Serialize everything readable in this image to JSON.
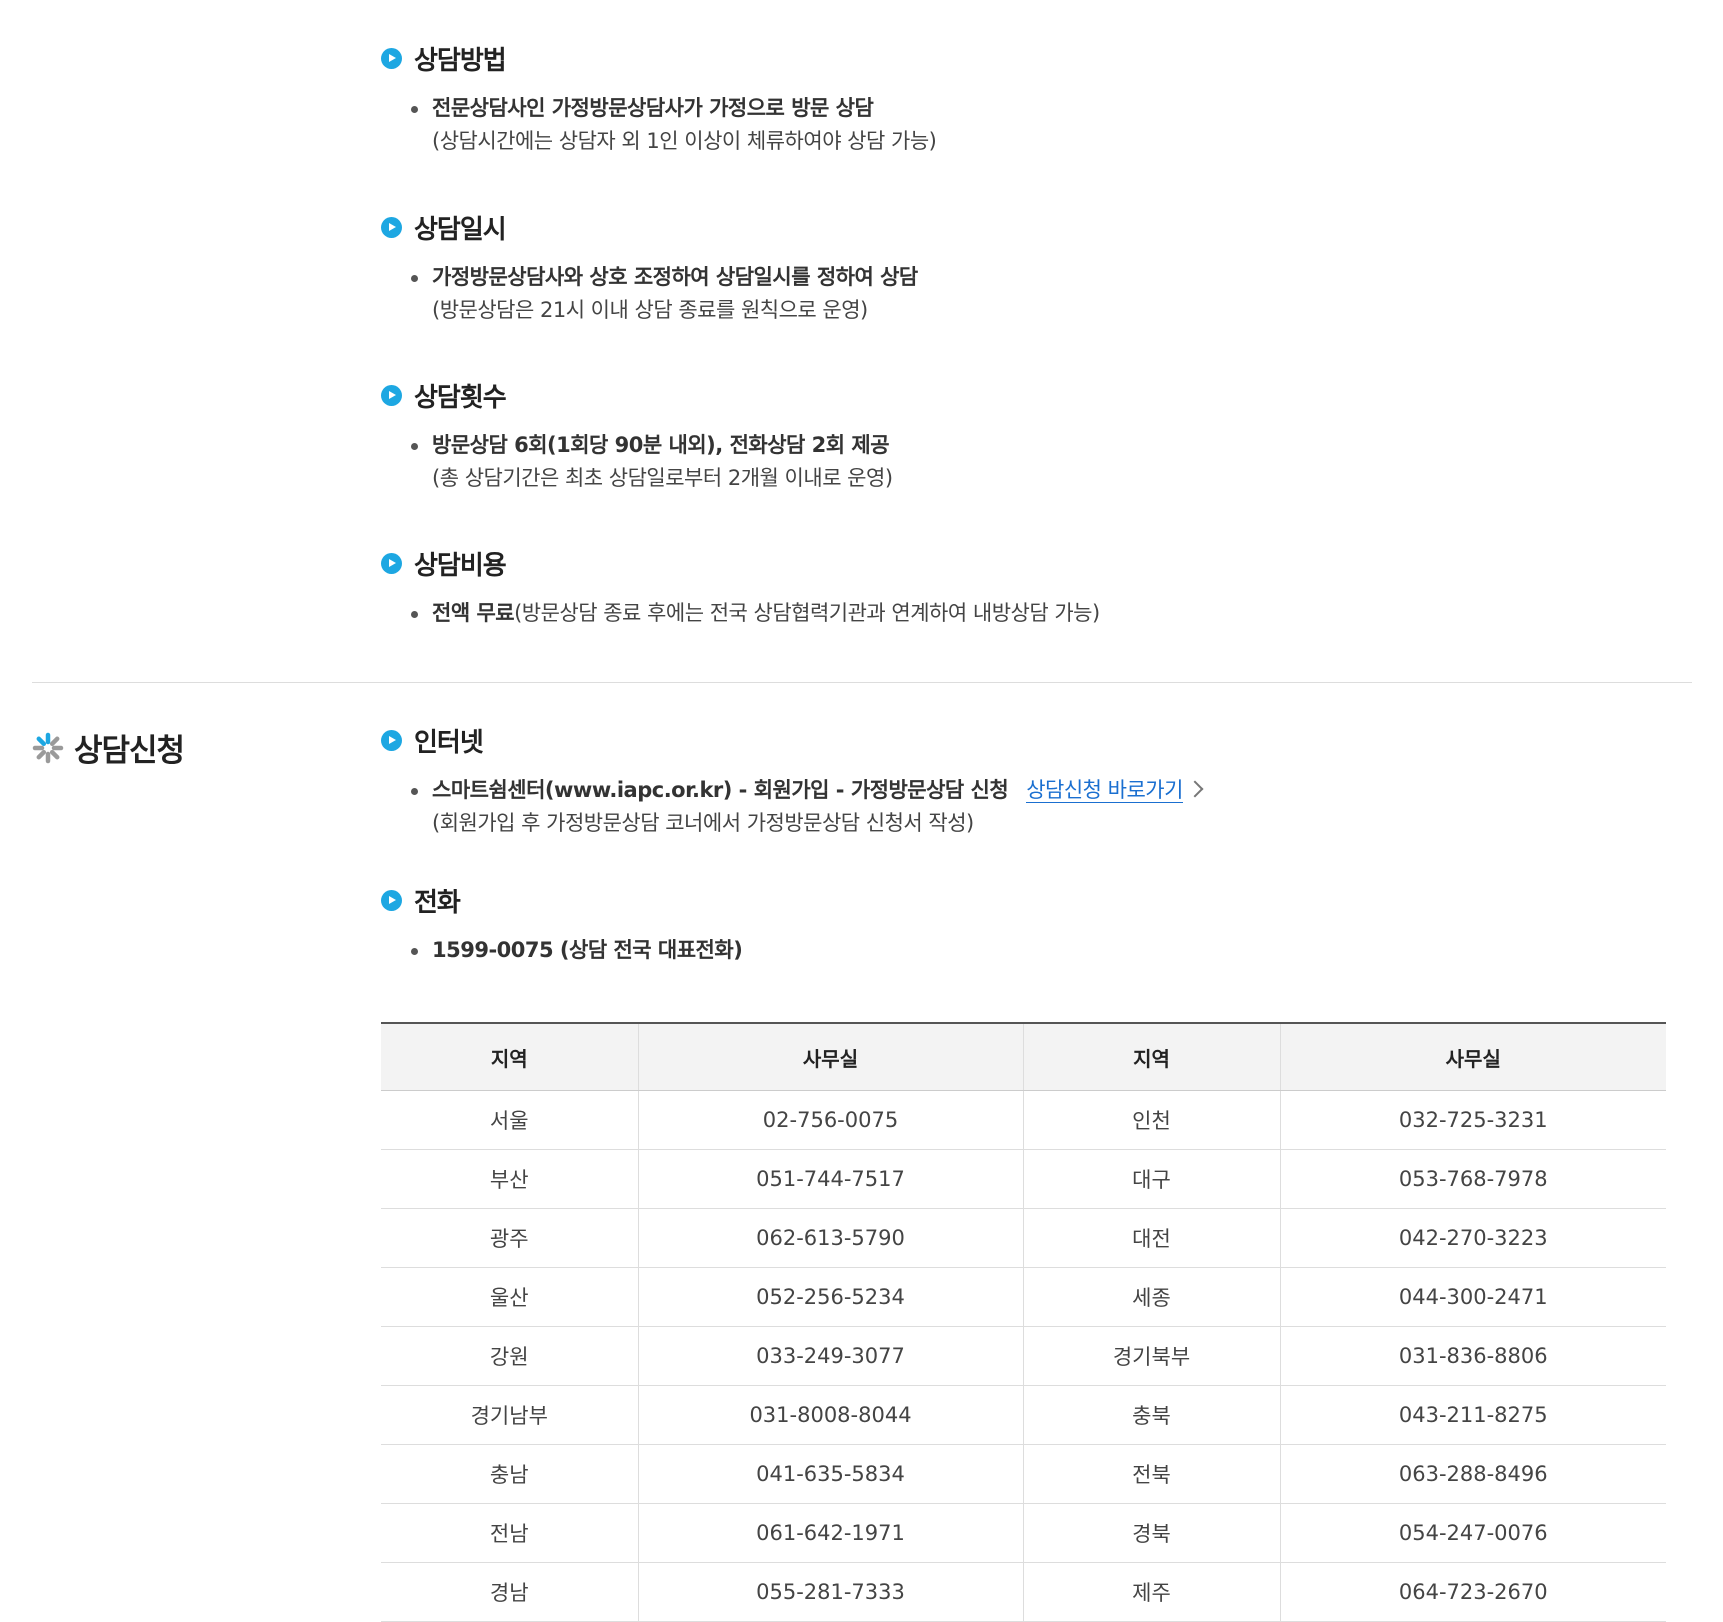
{
  "method": {
    "title": "상담방법",
    "line1": "전문상담사인 가정방문상담사가 가정으로 방문 상담",
    "line2": "(상담시간에는 상담자 외 1인 이상이 체류하여야 상담 가능)"
  },
  "schedule": {
    "title": "상담일시",
    "line1": "가정방문상담사와 상호 조정하여 상담일시를 정하여 상담",
    "line2": "(방문상담은 21시 이내 상담 종료를 원칙으로 운영)"
  },
  "count": {
    "title": "상담횟수",
    "line1": "방문상담 6회(1회당 90분 내외), 전화상담 2회 제공",
    "line2": "(총 상담기간은 최초 상담일로부터 2개월 이내로 운영)"
  },
  "cost": {
    "title": "상담비용",
    "strong": "전액 무료",
    "rest": "(방문상담 종료 후에는 전국 상담협력기관과 연계하여 내방상담 가능)"
  },
  "apply": {
    "title": "상담신청",
    "icon": "asterisk-icon",
    "internet": {
      "title": "인터넷",
      "line1": "스마트쉼센터(www.iapc.or.kr) - 회원가입 - 가정방문상담 신청",
      "link_label": "상담신청 바로가기",
      "line2": "(회원가입 후 가정방문상담 코너에서 가정방문상담 신청서 작성)"
    },
    "phone": {
      "title": "전화",
      "line1": "1599-0075 (상담 전국 대표전화)"
    }
  },
  "table": {
    "headers": [
      "지역",
      "사무실",
      "지역",
      "사무실"
    ],
    "rows": [
      [
        "서울",
        "02-756-0075",
        "인천",
        "032-725-3231"
      ],
      [
        "부산",
        "051-744-7517",
        "대구",
        "053-768-7978"
      ],
      [
        "광주",
        "062-613-5790",
        "대전",
        "042-270-3223"
      ],
      [
        "울산",
        "052-256-5234",
        "세종",
        "044-300-2471"
      ],
      [
        "강원",
        "033-249-3077",
        "경기북부",
        "031-836-8806"
      ],
      [
        "경기남부",
        "031-8008-8044",
        "충북",
        "043-211-8275"
      ],
      [
        "충남",
        "041-635-5834",
        "전북",
        "063-288-8496"
      ],
      [
        "전남",
        "061-642-1971",
        "경북",
        "054-247-0076"
      ],
      [
        "경남",
        "055-281-7333",
        "제주",
        "064-723-2670"
      ]
    ]
  },
  "colors": {
    "accent": "#1da7e2",
    "link": "#1a6fd0",
    "text": "#333333"
  }
}
